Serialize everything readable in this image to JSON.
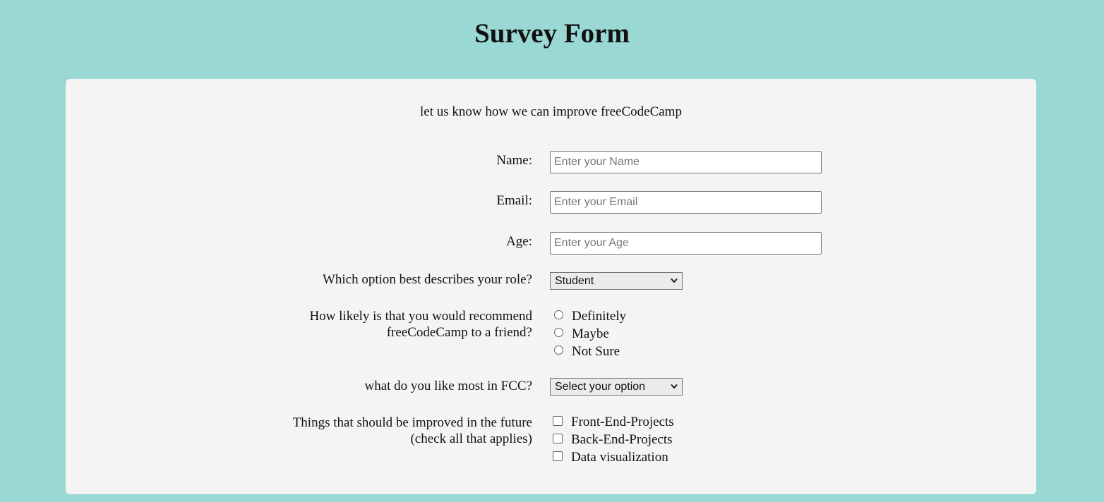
{
  "page": {
    "title": "Survey Form",
    "description": "let us know how we can improve freeCodeCamp",
    "colors": {
      "background": "#99d8d3",
      "card": "#f4f4f4"
    }
  },
  "form": {
    "name": {
      "label": "Name:",
      "value": "",
      "placeholder": "Enter your Name"
    },
    "email": {
      "label": "Email:",
      "value": "",
      "placeholder": "Enter your Email"
    },
    "age": {
      "label": "Age:",
      "value": "",
      "placeholder": "Enter your Age"
    },
    "role": {
      "label": "Which option best describes your role?",
      "selected": "Student"
    },
    "recommend": {
      "label_line1": "How likely is that you would recommend",
      "label_line2": "freeCodeCamp to a friend?",
      "options": [
        "Definitely",
        "Maybe",
        "Not Sure"
      ]
    },
    "like_most": {
      "label": "what do you like most in FCC?",
      "selected": "Select your option"
    },
    "improve": {
      "label_line1": "Things that should be improved in the future",
      "label_line2": "(check all that applies)",
      "options": [
        "Front-End-Projects",
        "Back-End-Projects",
        "Data visualization"
      ]
    }
  },
  "icons": {
    "select_arrow": "chevron-down-icon",
    "radio": "radio-circle-icon",
    "checkbox": "checkbox-square-icon"
  }
}
